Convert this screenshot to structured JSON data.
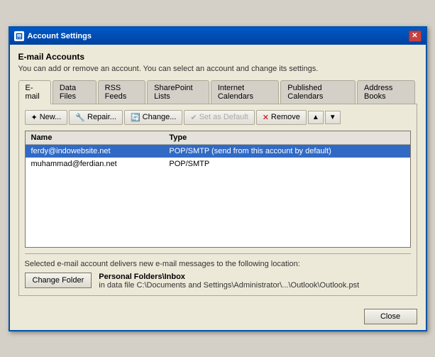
{
  "window": {
    "title": "Account Settings",
    "close_label": "✕"
  },
  "header": {
    "section_title": "E-mail Accounts",
    "section_desc": "You can add or remove an account. You can select an account and change its settings."
  },
  "tabs": [
    {
      "label": "E-mail",
      "active": true
    },
    {
      "label": "Data Files",
      "active": false
    },
    {
      "label": "RSS Feeds",
      "active": false
    },
    {
      "label": "SharePoint Lists",
      "active": false
    },
    {
      "label": "Internet Calendars",
      "active": false
    },
    {
      "label": "Published Calendars",
      "active": false
    },
    {
      "label": "Address Books",
      "active": false
    }
  ],
  "toolbar": {
    "new_label": "New...",
    "repair_label": "Repair...",
    "change_label": "Change...",
    "set_default_label": "Set as Default",
    "remove_label": "Remove",
    "up_icon": "▲",
    "down_icon": "▼"
  },
  "table": {
    "col_name": "Name",
    "col_type": "Type",
    "rows": [
      {
        "name": "ferdy@indowebsite.net",
        "type": "POP/SMTP (send from this account by default)",
        "selected": true
      },
      {
        "name": "muhammad@ferdian.net",
        "type": "POP/SMTP",
        "selected": false
      }
    ]
  },
  "footer": {
    "desc": "Selected e-mail account delivers new e-mail messages to the following location:",
    "change_folder_label": "Change Folder",
    "folder_name": "Personal Folders\\Inbox",
    "folder_path": "in data file C:\\Documents and Settings\\Administrator\\...\\Outlook\\Outlook.pst"
  },
  "bottom": {
    "close_label": "Close"
  }
}
